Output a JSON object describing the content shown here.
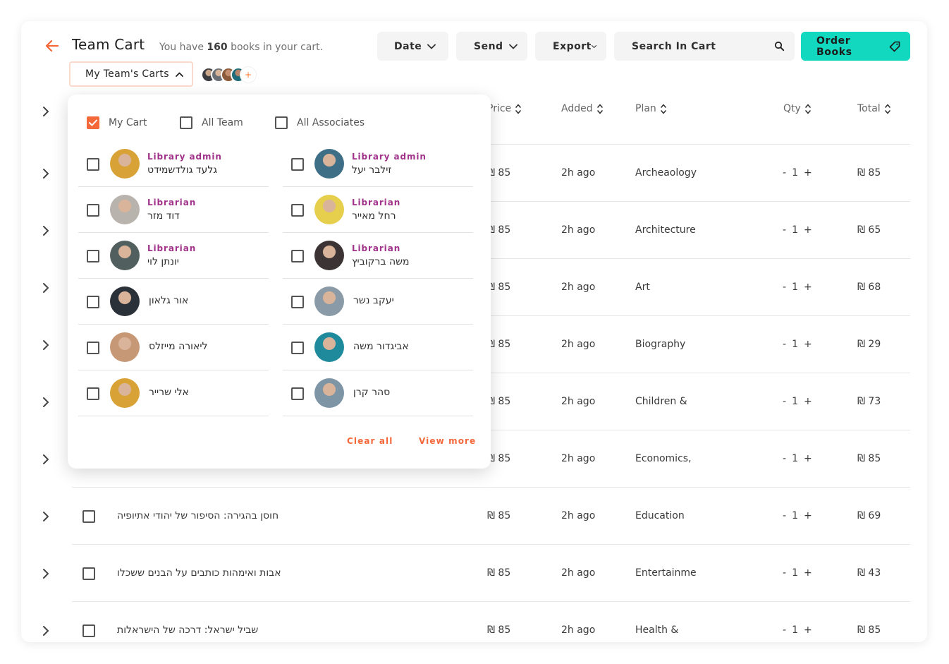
{
  "header": {
    "title": "Team Cart",
    "subtitle_prefix": "You have ",
    "cart_count": "160",
    "subtitle_suffix": " books in your cart.",
    "date_label": "Date",
    "send_label": "Send",
    "export_label": "Export",
    "search_placeholder": "Search In Cart",
    "order_label": "Order Books",
    "team_carts_label": "My Team's Carts",
    "avatars_more": "+"
  },
  "table": {
    "columns": {
      "price": "Price",
      "added": "Added",
      "plan": "Plan",
      "qty": "Qty",
      "total": "Total"
    },
    "rows": [
      {
        "name": "",
        "price": "₪ 85",
        "added": "2h ago",
        "plan": "Archeaology",
        "qty": "1",
        "total": "₪ 85"
      },
      {
        "name": "",
        "price": "₪ 85",
        "added": "2h ago",
        "plan": "Architecture",
        "qty": "1",
        "total": "₪ 65"
      },
      {
        "name": "",
        "price": "₪ 85",
        "added": "2h ago",
        "plan": "Art",
        "qty": "1",
        "total": "₪ 68"
      },
      {
        "name": "",
        "price": "₪ 85",
        "added": "2h ago",
        "plan": "Biography",
        "qty": "1",
        "total": "₪ 29"
      },
      {
        "name": "",
        "price": "₪ 85",
        "added": "2h ago",
        "plan": "Children &",
        "qty": "1",
        "total": "₪ 73"
      },
      {
        "name": "",
        "price": "₪ 85",
        "added": "2h ago",
        "plan": "Economics,",
        "qty": "1",
        "total": "₪ 85"
      },
      {
        "name": "חוסן בהגירה: הסיפור של יהודי אתיופיה",
        "price": "₪ 85",
        "added": "2h ago",
        "plan": "Education",
        "qty": "1",
        "total": "₪ 69"
      },
      {
        "name": "אבות ואימהות כותבים על הבנים ששכלו",
        "price": "₪ 85",
        "added": "2h ago",
        "plan": "Entertainme",
        "qty": "1",
        "total": "₪ 43"
      },
      {
        "name": "שביל ישראל: דרכה של הישראלות",
        "price": "₪ 85",
        "added": "2h ago",
        "plan": "Health &",
        "qty": "1",
        "total": "₪ 85"
      }
    ],
    "qty_minus": "-",
    "qty_plus": "+"
  },
  "panel": {
    "filters": [
      {
        "label": "My Cart",
        "checked": true
      },
      {
        "label": "All Team",
        "checked": false
      },
      {
        "label": "All Associates",
        "checked": false
      }
    ],
    "members_left": [
      {
        "role": "Library admin",
        "name": "גלעד גולדשמידט",
        "color": "#d8a236"
      },
      {
        "role": "Librarian",
        "name": "דוד מזר",
        "color": "#b9b3ad"
      },
      {
        "role": "Librarian",
        "name": "יונתן לוי",
        "color": "#51605f"
      },
      {
        "role": "",
        "name": "אור גלאון",
        "color": "#2b3138"
      },
      {
        "role": "",
        "name": "ליאורה מייזלס",
        "color": "#c79876"
      },
      {
        "role": "",
        "name": "אלי שרייר",
        "color": "#d8a236"
      }
    ],
    "members_right": [
      {
        "role": "Library admin",
        "name": "זילבר יעל",
        "color": "#3f6f86"
      },
      {
        "role": "Librarian",
        "name": "רחל מאייר",
        "color": "#e5cf4c"
      },
      {
        "role": "Librarian",
        "name": "משה ברקוביץ",
        "color": "#3c3434"
      },
      {
        "role": "",
        "name": "יעקב נשר",
        "color": "#8a9aa6"
      },
      {
        "role": "",
        "name": "אביגדור משה",
        "color": "#1f8a9c"
      },
      {
        "role": "",
        "name": "סהר קרן",
        "color": "#7e95a6"
      }
    ],
    "clear_all": "Clear all",
    "view_more": "View more"
  },
  "colors": {
    "accent": "#f4683a",
    "order_button": "#13d8c0",
    "role_text": "#a0328a"
  }
}
